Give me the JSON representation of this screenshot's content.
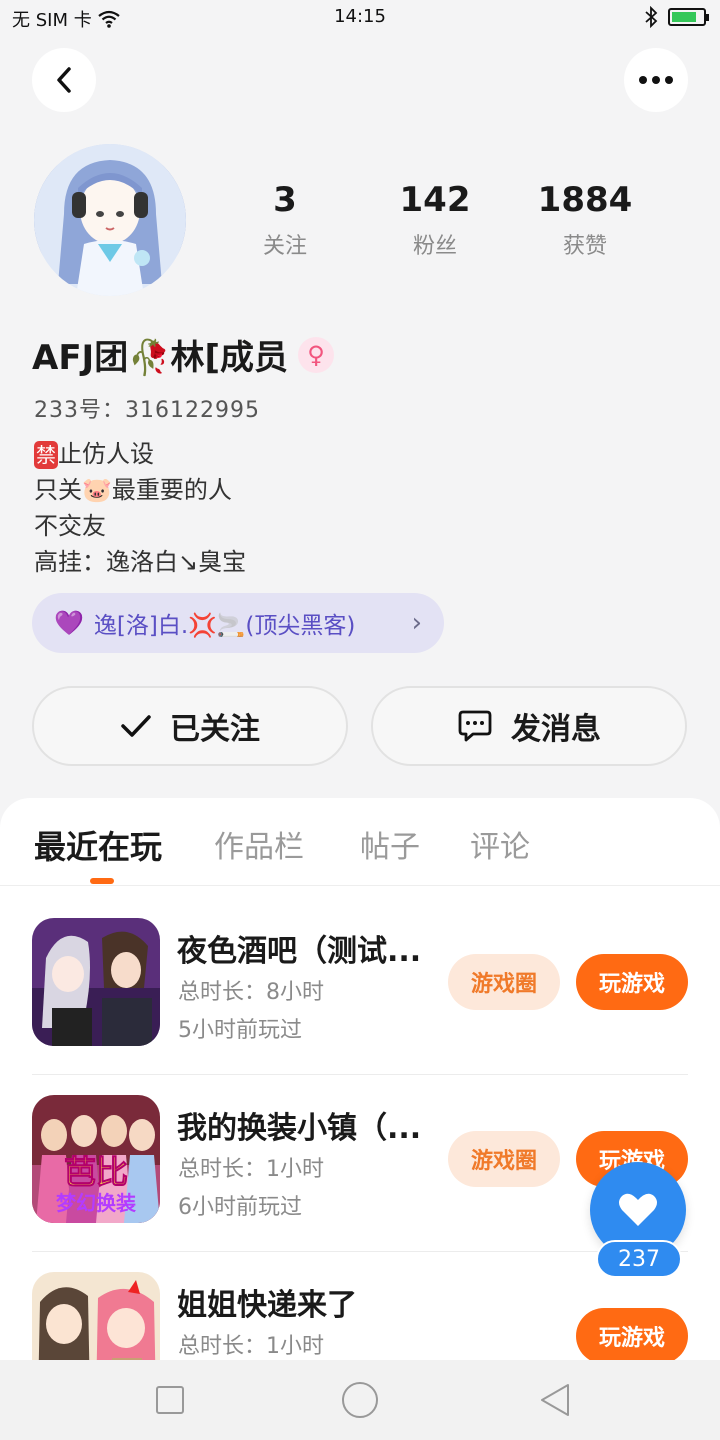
{
  "status_bar": {
    "carrier": "无 SIM 卡",
    "time": "14:15"
  },
  "profile": {
    "stats": [
      {
        "value": "3",
        "label": "关注"
      },
      {
        "value": "142",
        "label": "粉丝"
      },
      {
        "value": "1884",
        "label": "获赞"
      }
    ],
    "name": "AFJ团🥀林[成员",
    "gender_icon": "♀",
    "user_id": "233号：316122995",
    "bio": {
      "line1_badge": "禁",
      "line1": "止仿人设",
      "line2": "只关🐷最重要的人",
      "line3": "不交友",
      "line4": "高挂：逸洛白↘臭宝"
    },
    "tag_chip": {
      "icon": "💜",
      "text": "逸[洛]白.💢🚬(顶尖黑客)"
    }
  },
  "actions": {
    "follow_label": "已关注",
    "message_label": "发消息"
  },
  "tabs": [
    "最近在玩",
    "作品栏",
    "帖子",
    "评论"
  ],
  "games": [
    {
      "title": "夜色酒吧（测试...",
      "total_time": "总时长：8小时",
      "last_played": "5小时前玩过",
      "circle_label": "游戏圈",
      "play_label": "玩游戏"
    },
    {
      "title": "我的换装小镇（...",
      "total_time": "总时长：1小时",
      "last_played": "6小时前玩过",
      "circle_label": "游戏圈",
      "play_label": "玩游戏",
      "icon_text_top": "芭比",
      "icon_text_bottom": "梦幻换装"
    },
    {
      "title": "姐姐快递来了",
      "total_time": "总时长：1小时",
      "play_label": "玩游戏"
    }
  ],
  "like_fab": {
    "count": "237"
  },
  "colors": {
    "accent": "#ff6a13",
    "accent_soft": "#fde8da",
    "chip_purple": "#5a4fc4",
    "fab_blue": "#2f8bf0"
  }
}
